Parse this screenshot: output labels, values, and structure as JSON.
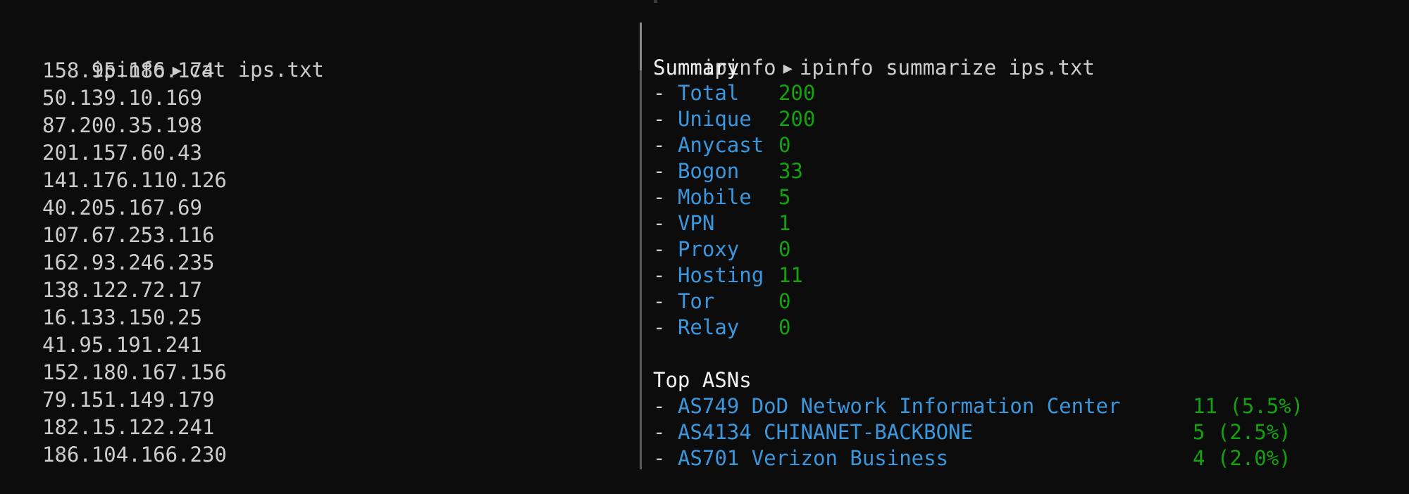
{
  "left_pane": {
    "prompt": {
      "name": "ipinfo",
      "arrow": "▶",
      "command": "cat ips.txt"
    },
    "ips": [
      "158.95.186.174",
      "50.139.10.169",
      "87.200.35.198",
      "201.157.60.43",
      "141.176.110.126",
      "40.205.167.69",
      "107.67.253.116",
      "162.93.246.235",
      "138.122.72.17",
      "16.133.150.25",
      "41.95.191.241",
      "152.180.167.156",
      "79.151.149.179",
      "182.15.122.241",
      "186.104.166.230"
    ]
  },
  "right_pane": {
    "prompt": {
      "name": "ipinfo",
      "arrow": "▶",
      "command": "ipinfo summarize ips.txt"
    },
    "summary_heading": "Summary",
    "summary": [
      {
        "key": "Total",
        "value": "200"
      },
      {
        "key": "Unique",
        "value": "200"
      },
      {
        "key": "Anycast",
        "value": "0"
      },
      {
        "key": "Bogon",
        "value": "33"
      },
      {
        "key": "Mobile",
        "value": "5"
      },
      {
        "key": "VPN",
        "value": "1"
      },
      {
        "key": "Proxy",
        "value": "0"
      },
      {
        "key": "Hosting",
        "value": "11"
      },
      {
        "key": "Tor",
        "value": "0"
      },
      {
        "key": "Relay",
        "value": "0"
      }
    ],
    "asn_heading": "Top ASNs",
    "asns": [
      {
        "name": "AS749 DoD Network Information Center",
        "value": "11 (5.5%)"
      },
      {
        "name": "AS4134 CHINANET-BACKBONE",
        "value": "5 (2.5%)"
      },
      {
        "name": "AS701 Verizon Business",
        "value": "4 (2.0%)"
      }
    ],
    "dash": "-"
  },
  "colors": {
    "background": "#0c0c0c",
    "text": "#cccccc",
    "key_blue": "#3a96dd",
    "value_green": "#13a10e"
  }
}
